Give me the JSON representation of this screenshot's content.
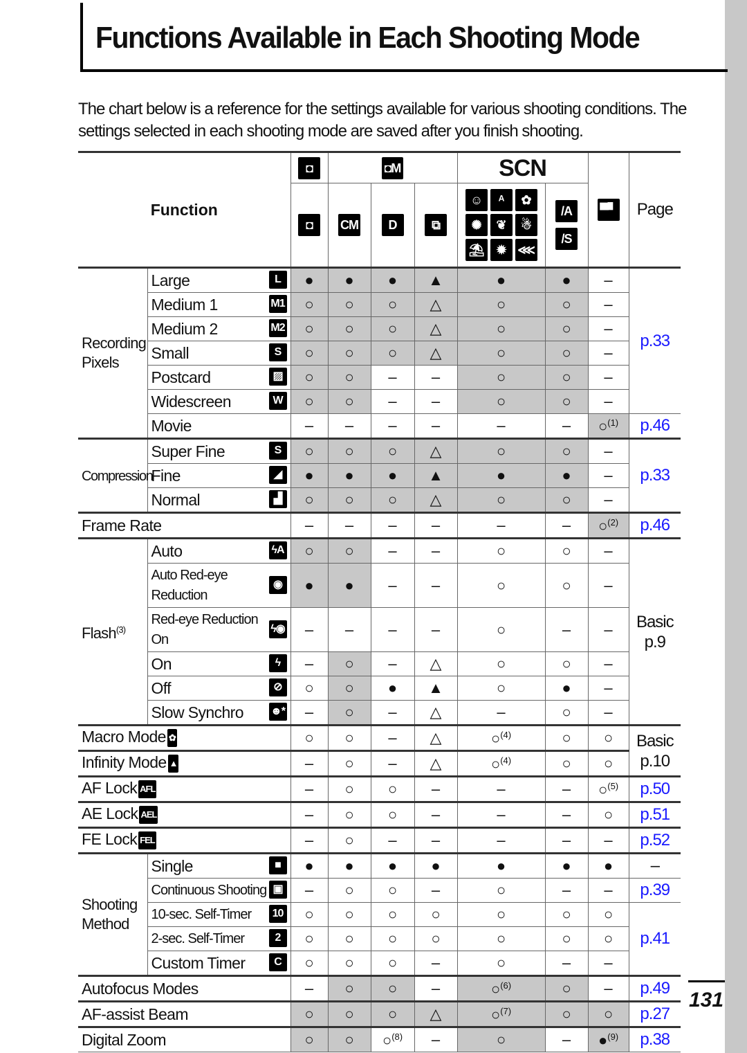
{
  "page": {
    "title": "Functions Available in Each Shooting Mode",
    "intro": "The chart below is a reference for the settings available for various shooting conditions. The settings selected in each shooting mode are saved after you finish shooting.",
    "page_number": "131"
  },
  "header": {
    "function_label": "Function",
    "page_label": "Page",
    "group_auto_icon": {
      "name": "camera-auto-icon",
      "glyph": "◘"
    },
    "group_manual": {
      "name": "camera-manual-icon",
      "glyph": "◘M"
    },
    "group_scn": "SCN",
    "movie_icon": {
      "name": "movie-camera-icon",
      "glyph": "▀▘"
    },
    "mode_icons": [
      {
        "name": "auto-mode-icon",
        "glyph": "◘"
      },
      {
        "name": "manual-mode-icon",
        "glyph": "CM"
      },
      {
        "name": "digital-macro-icon",
        "glyph": "D"
      },
      {
        "name": "stitch-assist-icon",
        "glyph": "⧉"
      }
    ],
    "scn_icons": [
      {
        "name": "portrait-icon",
        "glyph": "☺"
      },
      {
        "name": "kids-pets-icon",
        "glyph": "ᴬ"
      },
      {
        "name": "indoor-icon",
        "glyph": "✿"
      },
      {
        "name": "fireworks-icon",
        "glyph": "✺"
      },
      {
        "name": "foliage-icon",
        "glyph": "❦"
      },
      {
        "name": "snow-icon",
        "glyph": "☃"
      },
      {
        "name": "beach-icon",
        "glyph": "⛱"
      },
      {
        "name": "fireworks-burst-icon",
        "glyph": "✹"
      },
      {
        "name": "underwater-icon",
        "glyph": "⋘"
      }
    ],
    "scn_color_icons": [
      {
        "name": "color-accent-icon",
        "glyph": "/A"
      },
      {
        "name": "color-swap-icon",
        "glyph": "/S"
      }
    ]
  },
  "symbols": {
    "full": "●",
    "available": "○",
    "full_limited": "▲",
    "limited": "△",
    "none": "–"
  },
  "colors": {
    "shade": "#c8c8c8",
    "link": "#1a1aff",
    "sideband": "#c8c8c8"
  },
  "rows": [
    {
      "group": "Recording Pixels",
      "group_span": 7,
      "item": "Large",
      "icon": {
        "name": "large-icon",
        "text": "L"
      },
      "cells": [
        "●",
        "●",
        "●",
        "▲",
        "●",
        "●",
        "–"
      ],
      "shade": [
        1,
        1,
        1,
        1,
        1,
        1,
        0
      ],
      "page": "p.33",
      "page_span": 6,
      "page_link": true
    },
    {
      "item": "Medium 1",
      "icon": {
        "name": "medium1-icon",
        "text": "M1"
      },
      "cells": [
        "○",
        "○",
        "○",
        "△",
        "○",
        "○",
        "–"
      ],
      "shade": [
        1,
        1,
        1,
        1,
        1,
        1,
        0
      ]
    },
    {
      "item": "Medium 2",
      "icon": {
        "name": "medium2-icon",
        "text": "M2"
      },
      "cells": [
        "○",
        "○",
        "○",
        "△",
        "○",
        "○",
        "–"
      ],
      "shade": [
        1,
        1,
        1,
        1,
        1,
        1,
        0
      ]
    },
    {
      "item": "Small",
      "icon": {
        "name": "small-icon",
        "text": "S"
      },
      "cells": [
        "○",
        "○",
        "○",
        "△",
        "○",
        "○",
        "–"
      ],
      "shade": [
        1,
        1,
        1,
        1,
        1,
        1,
        0
      ]
    },
    {
      "item": "Postcard",
      "icon": {
        "name": "postcard-icon",
        "text": "▨"
      },
      "cells": [
        "○",
        "○",
        "–",
        "–",
        "○",
        "○",
        "–"
      ],
      "shade": [
        1,
        1,
        0,
        0,
        1,
        1,
        0
      ]
    },
    {
      "item": "Widescreen",
      "icon": {
        "name": "widescreen-icon",
        "text": "W"
      },
      "cells": [
        "○",
        "○",
        "–",
        "–",
        "○",
        "○",
        "–"
      ],
      "shade": [
        1,
        1,
        0,
        0,
        1,
        1,
        0
      ]
    },
    {
      "item": "Movie",
      "cells": [
        "–",
        "–",
        "–",
        "–",
        "–",
        "–",
        "○"
      ],
      "sup": {
        "6": "(1)"
      },
      "shade": [
        0,
        0,
        0,
        0,
        0,
        0,
        1
      ],
      "page": "p.46",
      "page_span": 1,
      "page_link": true
    },
    {
      "group": "Compression",
      "group_span": 3,
      "item": "Super Fine",
      "icon": {
        "name": "super-fine-icon",
        "text": "S"
      },
      "cells": [
        "○",
        "○",
        "○",
        "△",
        "○",
        "○",
        "–"
      ],
      "shade": [
        1,
        1,
        1,
        1,
        1,
        1,
        0
      ],
      "page": "p.33",
      "page_span": 3,
      "page_link": true
    },
    {
      "item": "Fine",
      "icon": {
        "name": "fine-icon",
        "text": "◢"
      },
      "cells": [
        "●",
        "●",
        "●",
        "▲",
        "●",
        "●",
        "–"
      ],
      "shade": [
        1,
        1,
        1,
        1,
        1,
        1,
        0
      ]
    },
    {
      "item": "Normal",
      "icon": {
        "name": "normal-icon",
        "text": "▟"
      },
      "cells": [
        "○",
        "○",
        "○",
        "△",
        "○",
        "○",
        "–"
      ],
      "shade": [
        1,
        1,
        1,
        1,
        1,
        1,
        0
      ]
    },
    {
      "full": "Frame Rate",
      "cells": [
        "–",
        "–",
        "–",
        "–",
        "–",
        "–",
        "○"
      ],
      "sup": {
        "6": "(2)"
      },
      "shade": [
        0,
        0,
        0,
        0,
        0,
        0,
        1
      ],
      "page": "p.46",
      "page_span": 1,
      "page_link": true
    },
    {
      "group": "Flash",
      "group_sup": "(3)",
      "group_span": 6,
      "item": "Auto",
      "icon": {
        "name": "flash-auto-icon",
        "text": "ϟA"
      },
      "cells": [
        "○",
        "○",
        "–",
        "–",
        "○",
        "○",
        "–"
      ],
      "shade": [
        1,
        1,
        0,
        0,
        0,
        0,
        0
      ],
      "page": "Basic p.9",
      "page_span": 6,
      "page_link": false
    },
    {
      "item": "Auto Red-eye Reduction",
      "tall": true,
      "narrow": true,
      "icon": {
        "name": "red-eye-icon",
        "text": "◉"
      },
      "cells": [
        "●",
        "●",
        "–",
        "–",
        "○",
        "○",
        "–"
      ],
      "shade": [
        1,
        1,
        0,
        0,
        0,
        0,
        0
      ]
    },
    {
      "item": "Red-eye Reduction On",
      "tall": true,
      "narrow": true,
      "icon": {
        "name": "flash-red-eye-icon",
        "text": "ϟ◉"
      },
      "cells": [
        "–",
        "–",
        "–",
        "–",
        "○",
        "–",
        "–"
      ],
      "shade": [
        0,
        0,
        0,
        0,
        0,
        0,
        0
      ]
    },
    {
      "item": "On",
      "icon": {
        "name": "flash-on-icon",
        "text": "ϟ"
      },
      "cells": [
        "–",
        "○",
        "–",
        "△",
        "○",
        "○",
        "–"
      ],
      "shade": [
        0,
        1,
        0,
        0,
        0,
        0,
        0
      ]
    },
    {
      "item": "Off",
      "icon": {
        "name": "flash-off-icon",
        "text": "⊘"
      },
      "cells": [
        "○",
        "○",
        "●",
        "▲",
        "○",
        "●",
        "–"
      ],
      "shade": [
        0,
        1,
        0,
        0,
        0,
        0,
        0
      ]
    },
    {
      "item": "Slow Synchro",
      "icon": {
        "name": "slow-synchro-icon",
        "text": "☻*"
      },
      "cells": [
        "–",
        "○",
        "–",
        "△",
        "–",
        "○",
        "–"
      ],
      "shade": [
        0,
        1,
        0,
        0,
        0,
        0,
        0
      ]
    },
    {
      "full": "Macro Mode",
      "full_icon": {
        "name": "macro-icon",
        "text": "✿"
      },
      "cells": [
        "○",
        "○",
        "–",
        "△",
        "○",
        "○",
        "○"
      ],
      "sup": {
        "4": "(4)"
      },
      "shade": [
        0,
        0,
        0,
        0,
        0,
        0,
        0
      ],
      "page": "Basic p.10",
      "page_span": 2,
      "page_link": false
    },
    {
      "full": "Infinity Mode",
      "full_icon": {
        "name": "infinity-mountain-icon",
        "text": "▲"
      },
      "cells": [
        "–",
        "○",
        "–",
        "△",
        "○",
        "○",
        "○"
      ],
      "sup": {
        "4": "(4)"
      },
      "shade": [
        0,
        0,
        0,
        0,
        0,
        0,
        0
      ]
    },
    {
      "full": "AF Lock",
      "full_icon": {
        "name": "af-lock-icon",
        "text": "AFL"
      },
      "cells": [
        "–",
        "○",
        "○",
        "–",
        "–",
        "–",
        "○"
      ],
      "sup": {
        "6": "(5)"
      },
      "shade": [
        0,
        0,
        0,
        0,
        0,
        0,
        0
      ],
      "page": "p.50",
      "page_span": 1,
      "page_link": true
    },
    {
      "full": "AE Lock",
      "full_icon": {
        "name": "ae-lock-icon",
        "text": "AEL"
      },
      "cells": [
        "–",
        "○",
        "○",
        "–",
        "–",
        "–",
        "○"
      ],
      "shade": [
        0,
        0,
        0,
        0,
        0,
        0,
        0
      ],
      "page": "p.51",
      "page_span": 1,
      "page_link": true
    },
    {
      "full": "FE Lock",
      "full_icon": {
        "name": "fe-lock-icon",
        "text": "FEL"
      },
      "cells": [
        "–",
        "○",
        "–",
        "–",
        "–",
        "–",
        "–"
      ],
      "shade": [
        0,
        0,
        0,
        0,
        0,
        0,
        0
      ],
      "page": "p.52",
      "page_span": 1,
      "page_link": true
    },
    {
      "group": "Shooting Method",
      "group_span": 5,
      "item": "Single",
      "icon": {
        "name": "single-shot-icon",
        "text": "■"
      },
      "cells": [
        "●",
        "●",
        "●",
        "●",
        "●",
        "●",
        "●"
      ],
      "shade": [
        0,
        0,
        0,
        0,
        0,
        0,
        0
      ],
      "page": "–",
      "page_span": 1,
      "page_link": false
    },
    {
      "item": "Continuous Shooting",
      "narrow": true,
      "icon": {
        "name": "continuous-shooting-icon",
        "text": "▣"
      },
      "cells": [
        "–",
        "○",
        "○",
        "–",
        "○",
        "–",
        "–"
      ],
      "shade": [
        0,
        0,
        0,
        0,
        0,
        0,
        0
      ],
      "page": "p.39",
      "page_span": 1,
      "page_link": true
    },
    {
      "item": "10-sec. Self-Timer",
      "narrow": true,
      "icon": {
        "name": "self-timer-10-icon",
        "text": "10"
      },
      "cells": [
        "○",
        "○",
        "○",
        "○",
        "○",
        "○",
        "○"
      ],
      "shade": [
        0,
        0,
        0,
        0,
        0,
        0,
        0
      ],
      "page": "p.41",
      "page_span": 3,
      "page_link": true
    },
    {
      "item": "2-sec. Self-Timer",
      "narrow": true,
      "icon": {
        "name": "self-timer-2-icon",
        "text": "2"
      },
      "cells": [
        "○",
        "○",
        "○",
        "○",
        "○",
        "○",
        "○"
      ],
      "shade": [
        0,
        0,
        0,
        0,
        0,
        0,
        0
      ]
    },
    {
      "item": "Custom Timer",
      "icon": {
        "name": "custom-timer-icon",
        "text": "C"
      },
      "cells": [
        "○",
        "○",
        "○",
        "–",
        "○",
        "–",
        "–"
      ],
      "shade": [
        0,
        0,
        0,
        0,
        0,
        0,
        0
      ]
    },
    {
      "full": "Autofocus Modes",
      "cells": [
        "–",
        "○",
        "○",
        "–",
        "○",
        "○",
        "–"
      ],
      "sup": {
        "4": "(6)"
      },
      "shade": [
        0,
        1,
        1,
        0,
        1,
        1,
        0
      ],
      "page": "p.49",
      "page_span": 1,
      "page_link": true
    },
    {
      "full": "AF-assist Beam",
      "cells": [
        "○",
        "○",
        "○",
        "△",
        "○",
        "○",
        "○"
      ],
      "sup": {
        "4": "(7)"
      },
      "shade": [
        1,
        1,
        1,
        1,
        1,
        1,
        1
      ],
      "page": "p.27",
      "page_span": 1,
      "page_link": true
    },
    {
      "full": "Digital Zoom",
      "cells": [
        "○",
        "○",
        "○",
        "–",
        "○",
        "–",
        "●"
      ],
      "sup": {
        "2": "(8)",
        "6": "(9)"
      },
      "shade": [
        1,
        1,
        0,
        0,
        1,
        0,
        1
      ],
      "page": "p.38",
      "page_span": 1,
      "page_link": true
    }
  ]
}
